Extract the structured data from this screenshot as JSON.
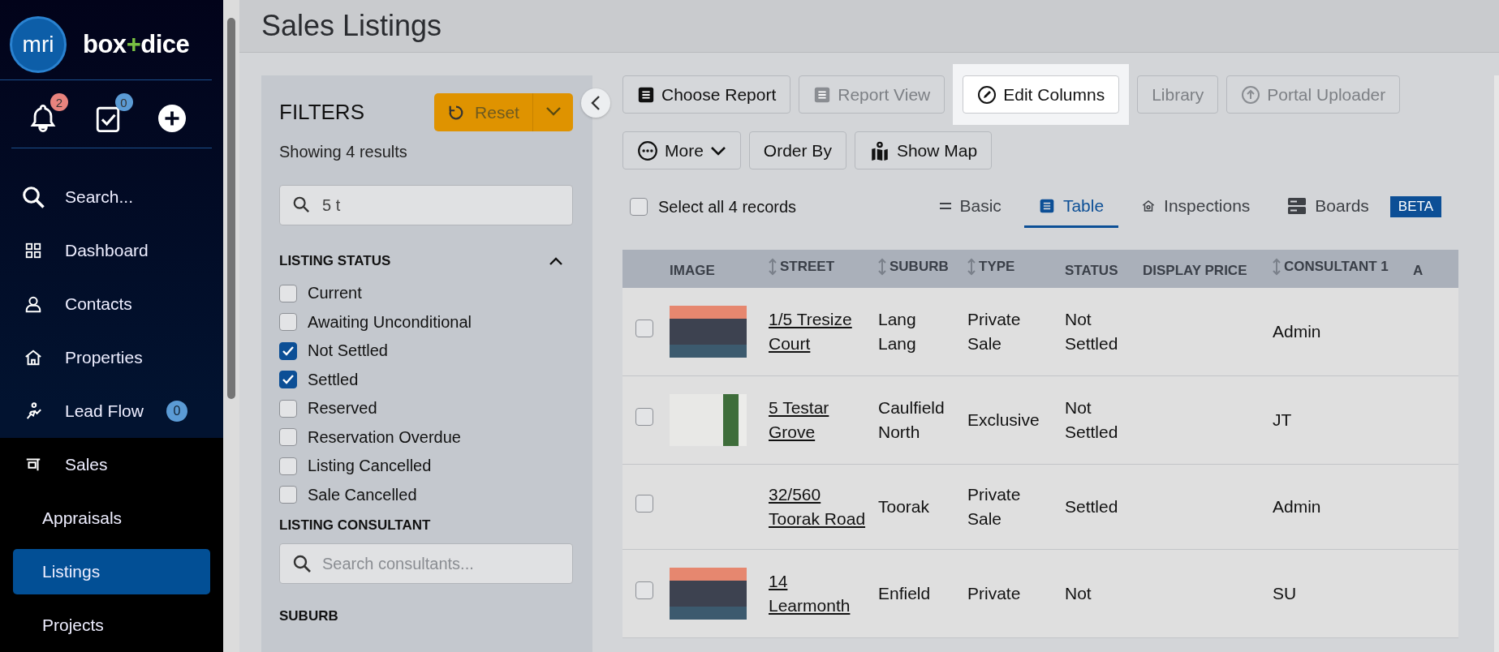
{
  "sidebar": {
    "logo_mark": "mri",
    "brand_parts": [
      {
        "text": "box",
        "accent": false
      },
      {
        "text": "+",
        "accent": true
      },
      {
        "text": "dice",
        "accent": false
      }
    ],
    "quick_actions": [
      {
        "kind": "bell",
        "badge": "2",
        "color": "#e8837e"
      },
      {
        "kind": "tasks",
        "badge": "0",
        "color": "#5b9bd5"
      },
      {
        "kind": "add"
      }
    ],
    "nav": [
      {
        "kind": "search",
        "label": "Search..."
      },
      {
        "kind": "dashboard",
        "label": "Dashboard"
      },
      {
        "kind": "contacts",
        "label": "Contacts"
      },
      {
        "kind": "properties",
        "label": "Properties"
      },
      {
        "kind": "leadflow",
        "label": "Lead Flow",
        "badge": "0"
      },
      {
        "kind": "sales",
        "label": "Sales",
        "expanded": true,
        "children": [
          {
            "label": "Appraisals",
            "selected": false
          },
          {
            "label": "Listings",
            "selected": true
          },
          {
            "label": "Projects",
            "selected": false
          }
        ]
      }
    ]
  },
  "page_title": "Sales Listings",
  "filters": {
    "title": "FILTERS",
    "reset_label": "Reset",
    "summary": "Showing 4 results",
    "search_value": "5 t",
    "sections": [
      {
        "kind": "checklist",
        "title": "LISTING STATUS",
        "expanded": true,
        "options": [
          {
            "label": "Current",
            "checked": false
          },
          {
            "label": "Awaiting Unconditional",
            "checked": false
          },
          {
            "label": "Not Settled",
            "checked": true
          },
          {
            "label": "Settled",
            "checked": true
          },
          {
            "label": "Reserved",
            "checked": false
          },
          {
            "label": "Reservation Overdue",
            "checked": false
          },
          {
            "label": "Listing Cancelled",
            "checked": false
          },
          {
            "label": "Sale Cancelled",
            "checked": false
          }
        ]
      },
      {
        "kind": "search",
        "title": "LISTING CONSULTANT",
        "placeholder": "Search consultants..."
      },
      {
        "kind": "plain",
        "title": "SUBURB"
      }
    ]
  },
  "toolbar": {
    "rows": [
      [
        {
          "kind": "report",
          "label": "Choose Report",
          "disabled": false,
          "highlighted": false
        },
        {
          "kind": "view",
          "label": "Report View",
          "disabled": true,
          "highlighted": false
        },
        {
          "kind": "edit",
          "label": "Edit Columns",
          "disabled": false,
          "highlighted": true
        },
        {
          "kind": "none",
          "label": "Library",
          "disabled": true,
          "highlighted": false
        },
        {
          "kind": "upload",
          "label": "Portal Uploader",
          "disabled": true,
          "highlighted": false
        }
      ],
      [
        {
          "kind": "more",
          "label": "More",
          "disabled": false,
          "highlighted": false
        },
        {
          "kind": "none",
          "label": "Order By",
          "disabled": false,
          "highlighted": false
        },
        {
          "kind": "map",
          "label": "Show Map",
          "disabled": false,
          "highlighted": false
        }
      ]
    ]
  },
  "select_all": {
    "label": "Select all 4 records",
    "checked": false
  },
  "view_tabs": [
    {
      "kind": "basic",
      "label": "Basic",
      "selected": false
    },
    {
      "kind": "table",
      "label": "Table",
      "selected": true
    },
    {
      "kind": "inspections",
      "label": "Inspections",
      "selected": false
    },
    {
      "kind": "boards",
      "label": "Boards",
      "badge": "BETA",
      "selected": false
    }
  ],
  "table": {
    "columns": [
      {
        "label": "IMAGE",
        "sortable": false
      },
      {
        "label": "STREET",
        "sortable": true
      },
      {
        "label": "SUBURB",
        "sortable": true
      },
      {
        "label": "TYPE",
        "sortable": true
      },
      {
        "label": "STATUS",
        "sortable": false
      },
      {
        "label": "DISPLAY PRICE",
        "sortable": false
      },
      {
        "label": "CONSULTANT 1",
        "sortable": true
      },
      {
        "label": "A",
        "sortable": false
      }
    ],
    "rows": [
      {
        "checked": false,
        "has_photo": true,
        "street": "1/5 Tresize Court",
        "suburb": "Lang Lang",
        "type": "Private Sale",
        "status": "Not Settled",
        "consultant": "Admin"
      },
      {
        "checked": false,
        "has_photo": true,
        "street": "5 Testar Grove",
        "suburb": "Caulfield North",
        "type": "Exclusive",
        "status": "Not Settled",
        "consultant": "JT"
      },
      {
        "checked": false,
        "has_photo": false,
        "street": "32/560 Toorak Road",
        "suburb": "Toorak",
        "type": "Private Sale",
        "status": "Settled",
        "consultant": "Admin"
      },
      {
        "checked": false,
        "has_photo": true,
        "street": "14 Learmonth",
        "suburb": "Enfield",
        "type": "Private",
        "status": "Not",
        "consultant": "SU"
      }
    ]
  }
}
